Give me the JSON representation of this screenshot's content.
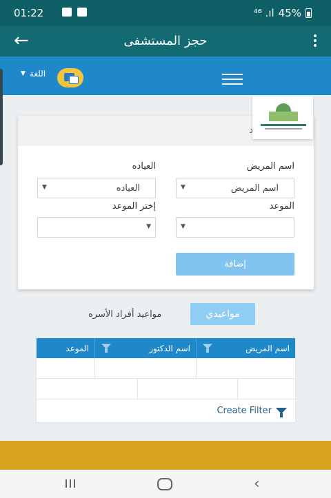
{
  "status_bar": {
    "time": "01:22",
    "network": "⁴⁶ .ıl",
    "battery": "45%"
  },
  "app_bar": {
    "title": "حجز المستشفى",
    "back_icon": "←"
  },
  "toolbar": {
    "language_label": "اللغة",
    "language_caret": "▼"
  },
  "form": {
    "header_text": "د",
    "patient_label": "اسم المريض",
    "patient_value": "اسم المريض",
    "clinic_label": "العياده",
    "clinic_value": "العياده",
    "appointment_label": "الموعد",
    "choose_appointment_label": "إختر الموعد",
    "add_button": "إضافة"
  },
  "tabs": {
    "my_appointments": "مواعيدي",
    "family_appointments": "مواعيد أفراد الأسره"
  },
  "grid": {
    "columns": [
      "اسم المريض",
      "اسم الدكتور",
      "الموعد"
    ],
    "create_filter": "Create Filter"
  },
  "colors": {
    "primary_dark": "#136a73",
    "primary": "#1e88c9",
    "accent_gold": "#d7a21f"
  }
}
